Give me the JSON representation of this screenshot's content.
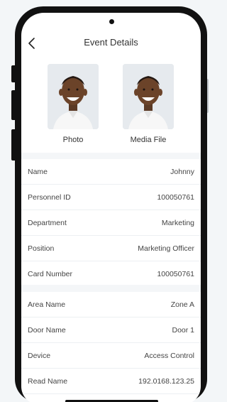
{
  "header": {
    "title": "Event Details"
  },
  "media": {
    "photo_label": "Photo",
    "media_file_label": "Media File"
  },
  "personnel_details": [
    {
      "label": "Name",
      "value": "Johnny"
    },
    {
      "label": "Personnel ID",
      "value": "100050761"
    },
    {
      "label": "Department",
      "value": "Marketing"
    },
    {
      "label": "Position",
      "value": "Marketing Officer"
    },
    {
      "label": "Card Number",
      "value": "100050761"
    }
  ],
  "access_details": [
    {
      "label": "Area Name",
      "value": "Zone A"
    },
    {
      "label": "Door Name",
      "value": "Door 1"
    },
    {
      "label": "Device",
      "value": "Access Control"
    },
    {
      "label": "Read Name",
      "value": "192.0168.123.25"
    }
  ],
  "colors": {
    "background": "#f3f6f8",
    "phone_frame": "#111111",
    "section_band": "#f4f6f8",
    "text": "#444444"
  },
  "icons": {
    "back": "chevron-left-icon"
  }
}
